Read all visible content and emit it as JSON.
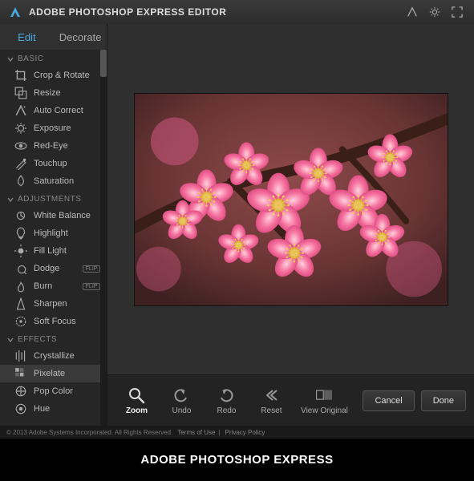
{
  "titlebar": {
    "app_name": "ADOBE PHOTOSHOP EXPRESS EDITOR"
  },
  "sidebar": {
    "tabs": {
      "edit": "Edit",
      "decorate": "Decorate"
    },
    "sections": [
      {
        "name": "BASIC",
        "items": [
          {
            "id": "crop-rotate",
            "label": "Crop & Rotate"
          },
          {
            "id": "resize",
            "label": "Resize"
          },
          {
            "id": "auto-correct",
            "label": "Auto Correct"
          },
          {
            "id": "exposure",
            "label": "Exposure"
          },
          {
            "id": "red-eye",
            "label": "Red-Eye"
          },
          {
            "id": "touchup",
            "label": "Touchup"
          },
          {
            "id": "saturation",
            "label": "Saturation"
          }
        ]
      },
      {
        "name": "ADJUSTMENTS",
        "items": [
          {
            "id": "white-balance",
            "label": "White Balance"
          },
          {
            "id": "highlight",
            "label": "Highlight"
          },
          {
            "id": "fill-light",
            "label": "Fill Light"
          },
          {
            "id": "dodge",
            "label": "Dodge",
            "badge": "FLIP"
          },
          {
            "id": "burn",
            "label": "Burn",
            "badge": "FLIP"
          },
          {
            "id": "sharpen",
            "label": "Sharpen"
          },
          {
            "id": "soft-focus",
            "label": "Soft Focus"
          }
        ]
      },
      {
        "name": "EFFECTS",
        "items": [
          {
            "id": "crystallize",
            "label": "Crystallize"
          },
          {
            "id": "pixelate",
            "label": "Pixelate",
            "selected": true
          },
          {
            "id": "pop-color",
            "label": "Pop Color"
          },
          {
            "id": "hue",
            "label": "Hue"
          }
        ]
      }
    ]
  },
  "toolbar": {
    "zoom": "Zoom",
    "undo": "Undo",
    "redo": "Redo",
    "reset": "Reset",
    "view_original": "View Original",
    "cancel": "Cancel",
    "done": "Done"
  },
  "footer": {
    "copyright": "© 2013 Adobe Systems Incorporated. All Rights Reserved.",
    "terms": "Terms of Use",
    "privacy": "Privacy Policy"
  },
  "caption": "ADOBE PHOTOSHOP EXPRESS"
}
